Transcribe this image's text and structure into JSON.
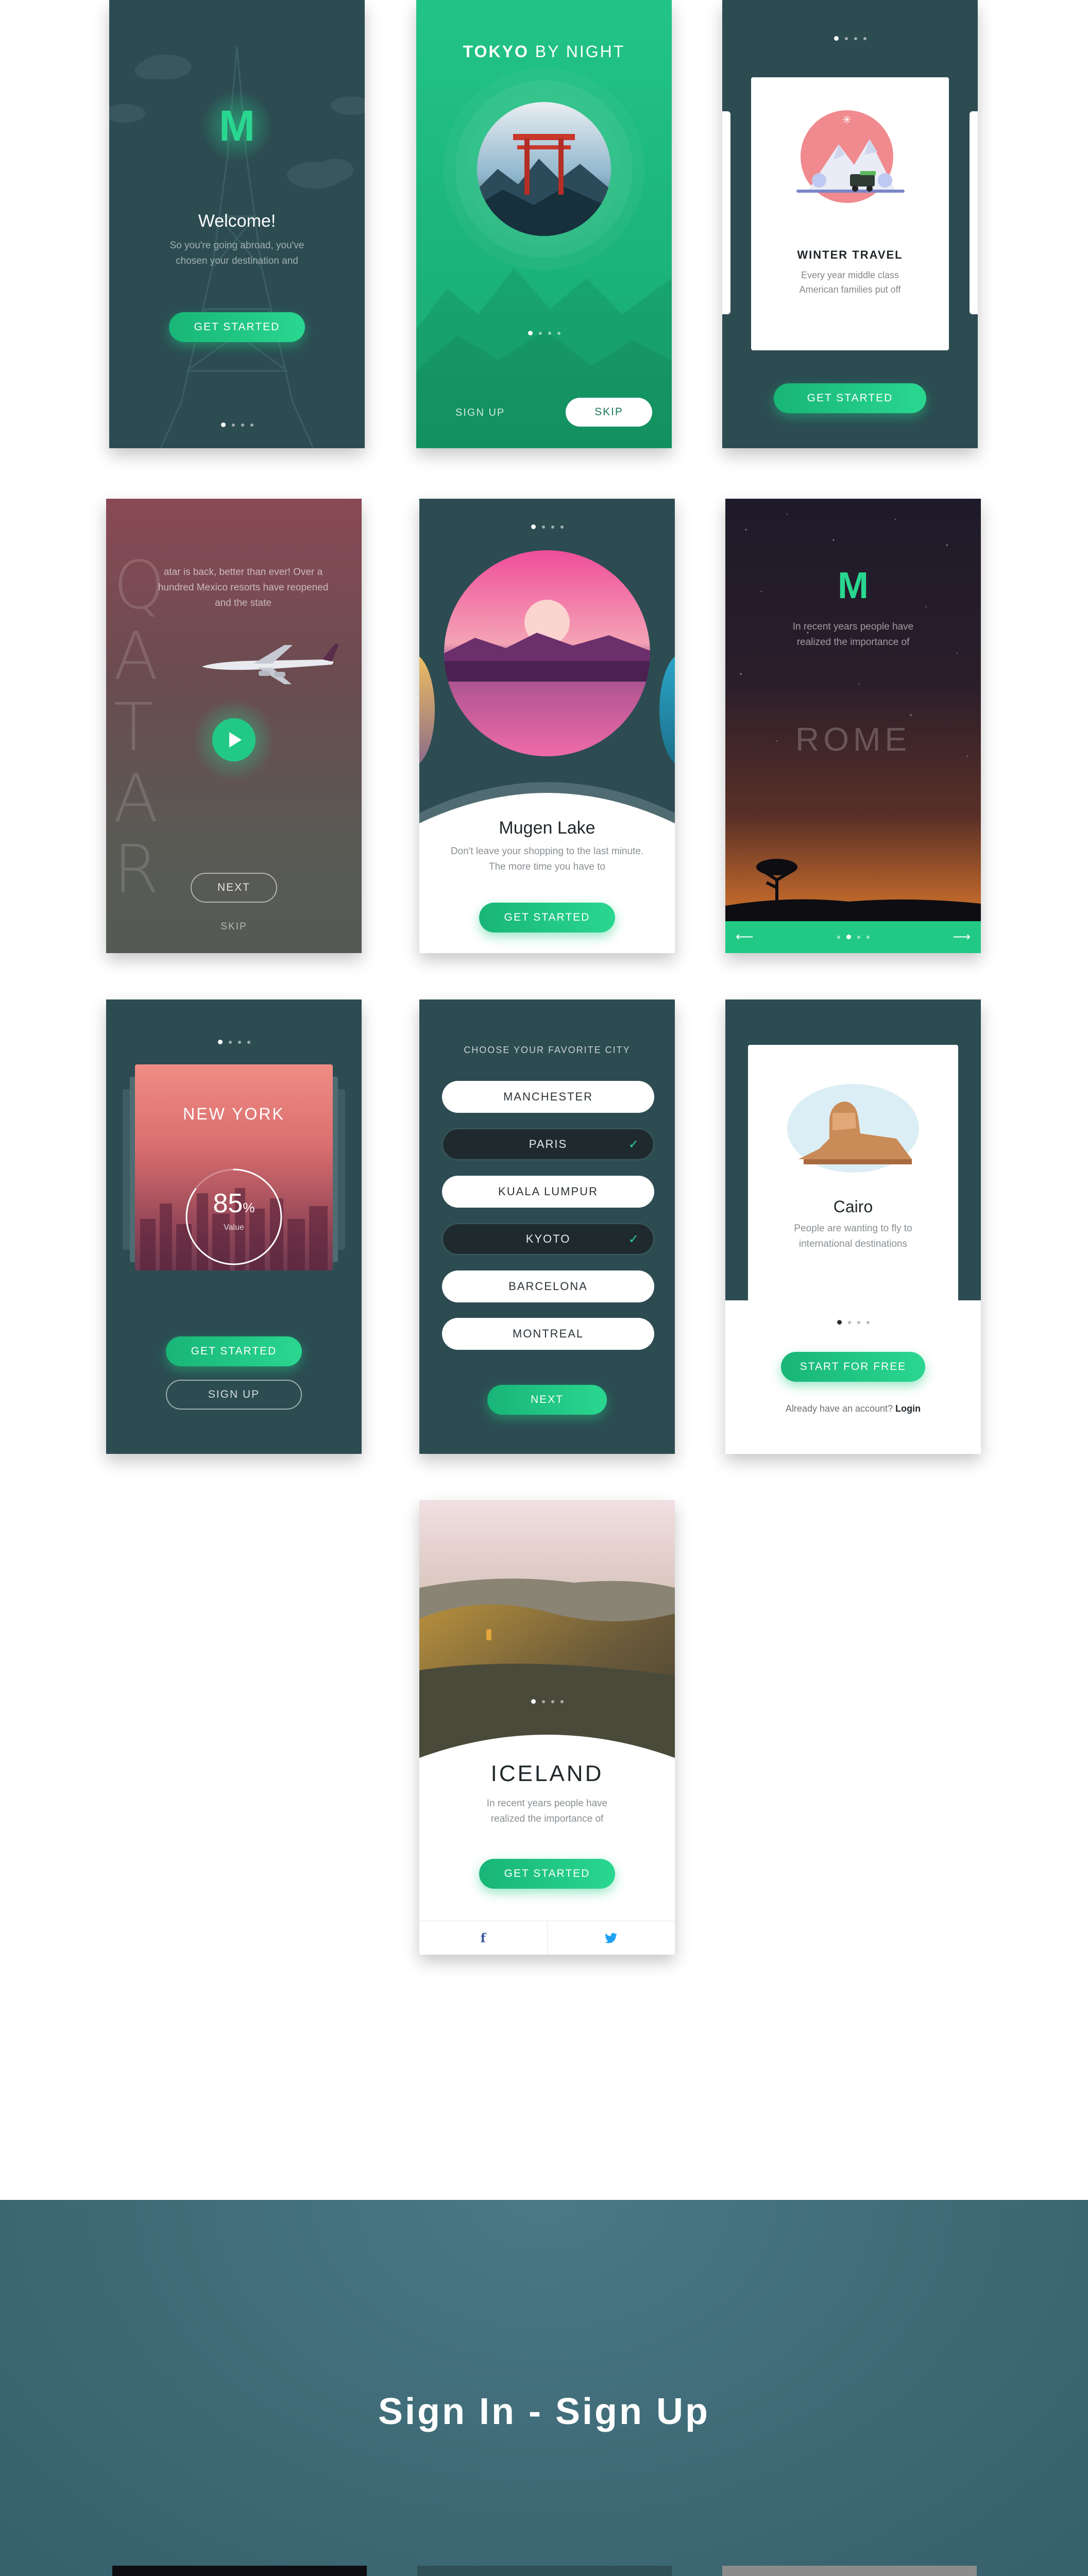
{
  "colors": {
    "accent": "#22c985",
    "teal_bg": "#2c4c52",
    "section_bg": "#3e6a76"
  },
  "welcome": {
    "title": "Welcome!",
    "subtitle": "So you're going abroad, you've chosen your destination and",
    "button": "GET STARTED",
    "logo_letter": "M"
  },
  "tokyo": {
    "title_bold": "TOKYO",
    "title_light": "BY NIGHT",
    "signup": "SIGN UP",
    "skip": "SKIP"
  },
  "winter": {
    "title": "WINTER TRAVEL",
    "subtitle": "Every year middle class American families put off",
    "button": "GET STARTED"
  },
  "qatar": {
    "bg_word": "QATAR",
    "subtitle": "atar is back, better than ever! Over a hundred Mexico resorts have reopened and the state",
    "next": "NEXT",
    "skip": "SKIP"
  },
  "mugen": {
    "title": "Mugen Lake",
    "subtitle": "Don't leave your shopping to the last minute. The more time you have to",
    "button": "GET STARTED"
  },
  "rome": {
    "logo_letter": "M",
    "subtitle": "In recent years people have realized the importance of",
    "city": "ROME",
    "prev_icon": "arrow-left-icon",
    "next_icon": "arrow-right-icon"
  },
  "newyork": {
    "city": "NEW YORK",
    "percent": "85",
    "percent_sign": "%",
    "label": "Value",
    "progress": 0.85,
    "button": "GET STARTED",
    "signup": "SIGN UP"
  },
  "cities": {
    "heading": "CHOOSE YOUR FAVORITE CITY",
    "items": [
      {
        "name": "MANCHESTER",
        "selected": false
      },
      {
        "name": "PARIS",
        "selected": true
      },
      {
        "name": "KUALA LUMPUR",
        "selected": false
      },
      {
        "name": "KYOTO",
        "selected": true
      },
      {
        "name": "BARCELONA",
        "selected": false
      },
      {
        "name": "MONTREAL",
        "selected": false
      }
    ],
    "button": "NEXT"
  },
  "cairo": {
    "title": "Cairo",
    "subtitle": "People are wanting to fly to international destinations",
    "button": "START FOR FREE",
    "account_text": "Already have an account?",
    "login": "Login"
  },
  "iceland": {
    "city": "ICELAND",
    "subtitle": "In recent years people have realized the importance of",
    "button": "GET STARTED",
    "facebook": "f"
  },
  "section": {
    "title": "Sign In - Sign Up"
  }
}
